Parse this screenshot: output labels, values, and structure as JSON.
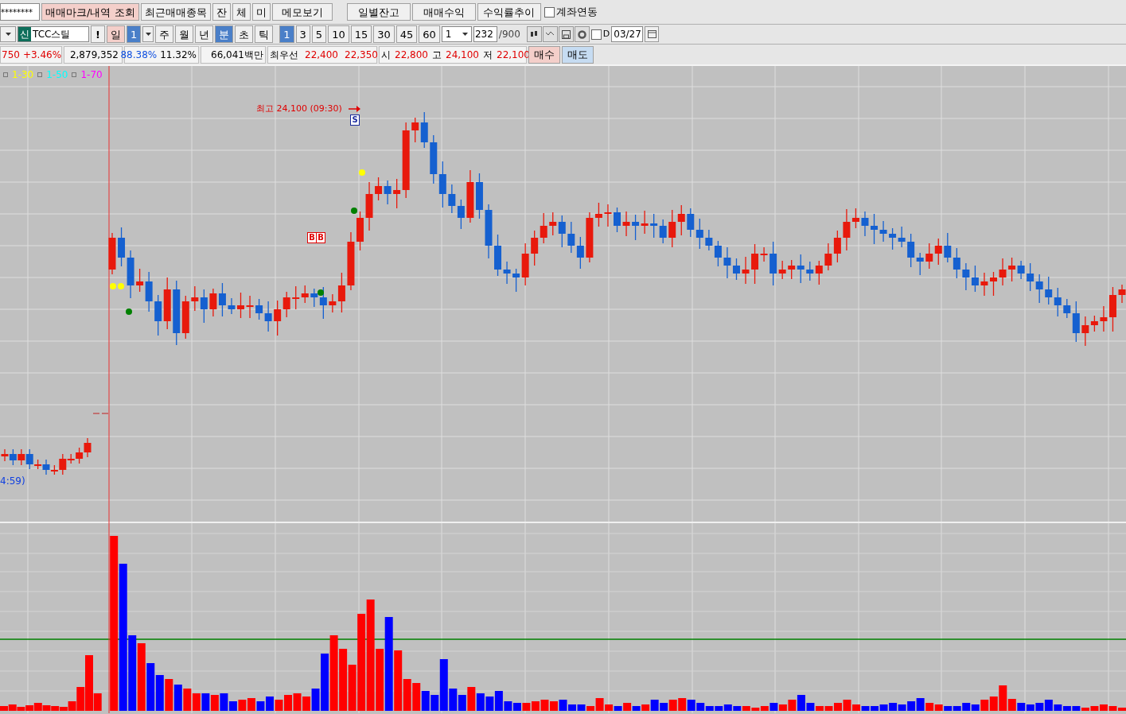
{
  "toolbar_1": {
    "account": "********",
    "buttons": [
      {
        "label": "매매마크/내역 조회",
        "kind": "pink"
      },
      {
        "label": "최근매매종목",
        "kind": "plain"
      },
      {
        "label": "잔",
        "kind": "plain"
      },
      {
        "label": "체",
        "kind": "plain"
      },
      {
        "label": "미",
        "kind": "plain"
      },
      {
        "label": "메모보기",
        "kind": "wide"
      }
    ],
    "right_buttons": [
      "일별잔고",
      "매매수익",
      "수익률추이"
    ],
    "link_checkbox": {
      "label": "계좌연동",
      "checked": false
    }
  },
  "toolbar_2": {
    "credit_badge": "신",
    "stock": "TCC스틸",
    "alert": "!",
    "periods": [
      {
        "label": "일",
        "selected": false,
        "kind": "pink"
      },
      {
        "label": "1",
        "selected": true,
        "kind": "dropdown"
      },
      {
        "label": "주",
        "selected": false,
        "kind": "plain"
      },
      {
        "label": "월",
        "selected": false,
        "kind": "plain"
      },
      {
        "label": "년",
        "selected": false,
        "kind": "plain"
      },
      {
        "label": "분",
        "selected": true,
        "kind": "plain"
      },
      {
        "label": "초",
        "selected": false,
        "kind": "plain"
      },
      {
        "label": "틱",
        "selected": false,
        "kind": "plain"
      }
    ],
    "intervals": [
      {
        "label": "1",
        "selected": true
      },
      {
        "label": "3",
        "selected": false
      },
      {
        "label": "5",
        "selected": false
      },
      {
        "label": "10",
        "selected": false
      },
      {
        "label": "15",
        "selected": false
      },
      {
        "label": "30",
        "selected": false
      },
      {
        "label": "45",
        "selected": false
      },
      {
        "label": "60",
        "selected": false
      }
    ],
    "interval_custom": "1",
    "count": "232",
    "count_max": "/900",
    "d_checkbox": {
      "label": "D",
      "checked": false
    },
    "date": "03/27"
  },
  "quote_bar": {
    "change": "750",
    "change_rate": "+3.46%",
    "volume": "2,879,352",
    "volume_ratio": "88.38%",
    "turnover": "11.32%",
    "amount": "66,041백만",
    "best_label": "최우선",
    "best_ask": "22,400",
    "best_bid": "22,350",
    "ohl": [
      {
        "label": "시",
        "value": "22,800"
      },
      {
        "label": "고",
        "value": "24,100"
      },
      {
        "label": "저",
        "value": "22,100"
      }
    ],
    "buy": "매수",
    "sell": "매도"
  },
  "chart": {
    "legend": [
      {
        "label": "1-30",
        "color": "#ffff00"
      },
      {
        "label": "1-50",
        "color": "#00ffff"
      },
      {
        "label": "1-70",
        "color": "#ff00ff"
      }
    ],
    "high_note": "최고 24,100 (09:30)",
    "low_note": "4:59)",
    "markers": [
      {
        "label": "B",
        "kind": "buy"
      },
      {
        "label": "B",
        "kind": "buy"
      },
      {
        "label": "S",
        "kind": "sell"
      }
    ]
  }
}
